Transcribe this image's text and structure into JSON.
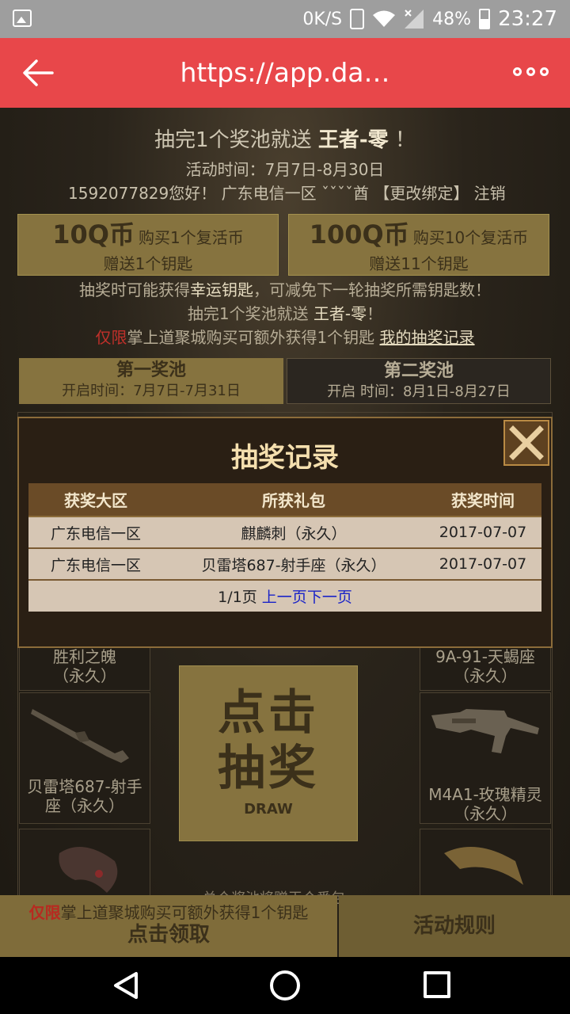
{
  "status_bar": {
    "net_speed": "0K/S",
    "battery": "48%",
    "battery_level": 0.48,
    "time": "23:27",
    "icons": [
      "image-icon",
      "vibrate-icon",
      "wifi-icon",
      "signal-icon",
      "battery-icon"
    ]
  },
  "app_bar": {
    "url": "https://app.da…",
    "back_icon": "back-arrow-icon",
    "more_icon": "more-dots-icon"
  },
  "page": {
    "hero_title_prefix": "抽完1个奖池就送",
    "hero_title_bold": "王者-零",
    "hero_title_suffix": "！",
    "event_time": "活动时间：7月7日-8月30日",
    "user_line": "1592077829您好！ 广东电信一区 ˇˇˇˇ酋 【更改绑定】 注销",
    "buy_options": [
      {
        "price": "10Q币",
        "desc": "购买1个复活币",
        "gift": "赠送1个钥匙"
      },
      {
        "price": "100Q币",
        "desc": "购买10个复活币",
        "gift": "赠送11个钥匙"
      }
    ],
    "info_line_1_pre": "抽奖时可能获得",
    "info_line_1_hl": "幸运钥匙",
    "info_line_1_post": "，可减免下一轮抽奖所需钥匙数！",
    "info_line_2_pre": "抽完1个奖池就送 ",
    "info_line_2_hl": "王者-零",
    "info_line_2_post": "！",
    "info_line_3_red": "仅限",
    "info_line_3_text": "掌上道聚城购买可额外获得1个钥匙",
    "my_records_link": "我的抽奖记录",
    "pools": [
      {
        "title": "第一奖池",
        "time": "开启时间：7月7日-7月31日"
      },
      {
        "title": "第二奖池",
        "time": "开启 时间：8月1日-8月27日"
      }
    ],
    "items": [
      {
        "name": "胜利之魄",
        "tag": "（永久）"
      },
      {
        "name": "9A-91-天蝎座",
        "tag": "（永久）"
      },
      {
        "name": "贝雷塔687-射手",
        "tag": "座（永久）"
      },
      {
        "name": "M4A1-玫瑰精灵",
        "tag": "（永久）"
      }
    ],
    "draw_button": {
      "line1": "点击",
      "line2": "抽奖",
      "en": "DRAW"
    },
    "bottom_note": "兑个奖池将赠王个番包",
    "bottom_bar": {
      "red": "仅限",
      "text": "掌上道聚城购买可额外获得1个钥匙",
      "claim": "点击领取",
      "rules": "活动规则"
    }
  },
  "modal": {
    "title": "抽奖记录",
    "close_icon": "close-x-icon",
    "columns": [
      "获奖大区",
      "所获礼包",
      "获奖时间"
    ],
    "rows": [
      [
        "广东电信一区",
        "麒麟刺（永久）",
        "2017-07-07"
      ],
      [
        "广东电信一区",
        "贝雷塔687-射手座（永久）",
        "2017-07-07"
      ]
    ],
    "pager_text": "1/1页",
    "prev_page": "上一页",
    "next_page": "下一页"
  },
  "nav_bar": {
    "icons": [
      "nav-back-icon",
      "nav-home-icon",
      "nav-recent-icon"
    ]
  }
}
